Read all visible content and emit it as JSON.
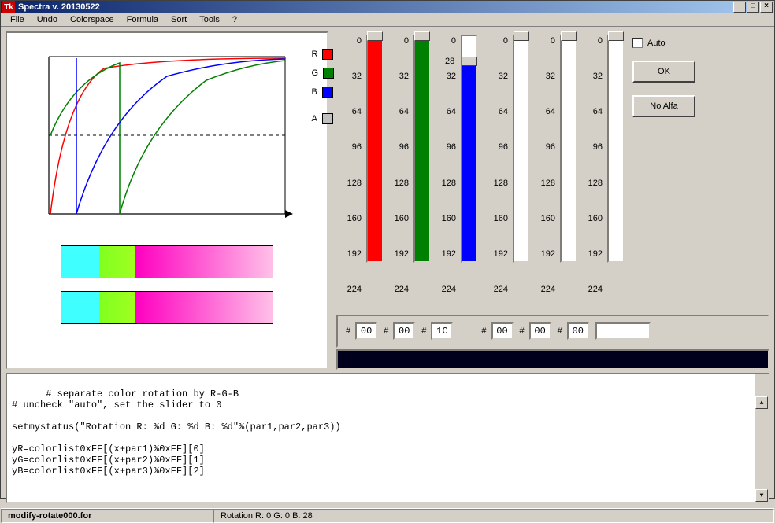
{
  "title": "Spectra v. 20130522",
  "titleIcon": "Tk",
  "menu": [
    "File",
    "Undo",
    "Colorspace",
    "Formula",
    "Sort",
    "Tools",
    "?"
  ],
  "legend": {
    "r": {
      "label": "R",
      "color": "#ff0000"
    },
    "g": {
      "label": "G",
      "color": "#008000"
    },
    "b": {
      "label": "B",
      "color": "#0000ff"
    },
    "a": {
      "label": "A",
      "color": "#808080"
    }
  },
  "ticks": [
    "0",
    "32",
    "64",
    "96",
    "128",
    "160",
    "192",
    "224"
  ],
  "sliders": [
    {
      "name": "r-slider",
      "fill": "#ff0000",
      "pos": 0,
      "indicator": ""
    },
    {
      "name": "g-slider",
      "fill": "#008000",
      "pos": 0,
      "indicator": ""
    },
    {
      "name": "b-slider",
      "fill": "#0000ff",
      "pos": 28,
      "indicator": "28"
    },
    {
      "name": "slider-4",
      "fill": "",
      "pos": 0,
      "indicator": ""
    },
    {
      "name": "slider-5",
      "fill": "",
      "pos": 0,
      "indicator": ""
    },
    {
      "name": "slider-6",
      "fill": "",
      "pos": 0,
      "indicator": ""
    }
  ],
  "auto": {
    "label": "Auto",
    "checked": false
  },
  "buttons": {
    "ok": "OK",
    "noalfa": "No Alfa"
  },
  "hex": {
    "hash": "#",
    "values": [
      "00",
      "00",
      "1C",
      "00",
      "00",
      "00"
    ]
  },
  "stripColor": "#00001c",
  "code": "# separate color rotation by R-G-B\n# uncheck \"auto\", set the slider to 0\n\nsetmystatus(\"Rotation R: %d G: %d B: %d\"%(par1,par2,par3))\n\nyR=colorlist0xFF[(x+par1)%0xFF][0]\nyG=colorlist0xFF[(x+par2)%0xFF][1]\nyB=colorlist0xFF[(x+par3)%0xFF][2]",
  "status": {
    "file": "modify-rotate000.for",
    "rotation": "Rotation R: 0 G: 0 B: 28"
  }
}
